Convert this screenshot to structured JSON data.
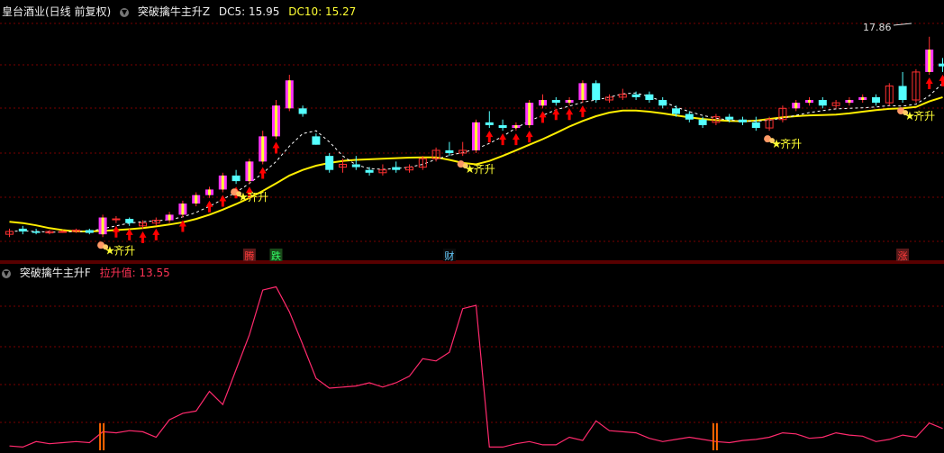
{
  "top_panel": {
    "stock_label": "皇台酒业(日线 前复权)",
    "indicator_name": "突破擒牛主升Z",
    "dc5_label": "DC5: 15.95",
    "dc10_label": "DC10: 15.27",
    "peak_price": "17.86",
    "signal_label": "齐升",
    "tags": [
      "腾",
      "跌",
      "财",
      "涨"
    ]
  },
  "bottom_panel": {
    "indicator_name": "突破擒牛主升F",
    "value_label": "拉升值: 13.55"
  },
  "colors": {
    "background": "#000000",
    "grid": "#7a0000",
    "up_candle": "#ff3030",
    "down_candle": "#54ffff",
    "highlight_bar": "#ff33ff",
    "highlight_bar2": "#ffff33",
    "ma_yellow": "#ffee00",
    "ma_white": "#ffffff",
    "bottom_line": "#ff2a6d",
    "bottom_flag": "#ff6600",
    "arrow": "#ff0000",
    "dc10": "#ffff33"
  },
  "chart_data": {
    "type": "candlestick",
    "note_series": "daily OHLC-like bars estimated visually",
    "candles": [
      {
        "o": 10.8,
        "h": 11.0,
        "l": 10.7,
        "c": 10.9
      },
      {
        "o": 11.0,
        "h": 11.1,
        "l": 10.8,
        "c": 10.9
      },
      {
        "o": 10.9,
        "h": 11.0,
        "l": 10.8,
        "c": 10.85
      },
      {
        "o": 10.85,
        "h": 10.95,
        "l": 10.8,
        "c": 10.9
      },
      {
        "o": 10.9,
        "h": 10.95,
        "l": 10.85,
        "c": 10.9
      },
      {
        "o": 10.9,
        "h": 11.0,
        "l": 10.85,
        "c": 10.95
      },
      {
        "o": 10.95,
        "h": 11.0,
        "l": 10.8,
        "c": 10.85
      },
      {
        "o": 10.8,
        "h": 11.5,
        "l": 10.7,
        "c": 11.4
      },
      {
        "o": 11.35,
        "h": 11.45,
        "l": 11.2,
        "c": 11.35
      },
      {
        "o": 11.35,
        "h": 11.4,
        "l": 11.1,
        "c": 11.2
      },
      {
        "o": 11.1,
        "h": 11.3,
        "l": 11.0,
        "c": 11.2
      },
      {
        "o": 11.2,
        "h": 11.4,
        "l": 11.1,
        "c": 11.3
      },
      {
        "o": 11.3,
        "h": 11.6,
        "l": 11.2,
        "c": 11.5
      },
      {
        "o": 11.5,
        "h": 12.0,
        "l": 11.4,
        "c": 11.9
      },
      {
        "o": 11.9,
        "h": 12.3,
        "l": 11.8,
        "c": 12.2
      },
      {
        "o": 12.2,
        "h": 12.5,
        "l": 12.1,
        "c": 12.4
      },
      {
        "o": 12.4,
        "h": 13.0,
        "l": 12.3,
        "c": 12.9
      },
      {
        "o": 12.9,
        "h": 13.1,
        "l": 12.6,
        "c": 12.7
      },
      {
        "o": 12.7,
        "h": 13.5,
        "l": 12.6,
        "c": 13.4
      },
      {
        "o": 13.4,
        "h": 14.5,
        "l": 13.3,
        "c": 14.3
      },
      {
        "o": 14.3,
        "h": 15.6,
        "l": 14.2,
        "c": 15.4
      },
      {
        "o": 15.3,
        "h": 16.5,
        "l": 15.2,
        "c": 16.3
      },
      {
        "o": 15.3,
        "h": 15.4,
        "l": 15.0,
        "c": 15.1
      },
      {
        "o": 14.3,
        "h": 14.4,
        "l": 14.0,
        "c": 14.0
      },
      {
        "o": 13.6,
        "h": 13.7,
        "l": 13.0,
        "c": 13.1
      },
      {
        "o": 13.2,
        "h": 13.5,
        "l": 13.0,
        "c": 13.3
      },
      {
        "o": 13.3,
        "h": 13.6,
        "l": 13.1,
        "c": 13.2
      },
      {
        "o": 13.1,
        "h": 13.2,
        "l": 12.9,
        "c": 13.0
      },
      {
        "o": 13.0,
        "h": 13.3,
        "l": 12.9,
        "c": 13.1
      },
      {
        "o": 13.2,
        "h": 13.4,
        "l": 13.0,
        "c": 13.1
      },
      {
        "o": 13.1,
        "h": 13.3,
        "l": 13.0,
        "c": 13.2
      },
      {
        "o": 13.2,
        "h": 13.6,
        "l": 13.1,
        "c": 13.5
      },
      {
        "o": 13.5,
        "h": 13.9,
        "l": 13.4,
        "c": 13.8
      },
      {
        "o": 13.8,
        "h": 14.1,
        "l": 13.6,
        "c": 13.7
      },
      {
        "o": 13.7,
        "h": 14.1,
        "l": 13.6,
        "c": 13.8
      },
      {
        "o": 13.8,
        "h": 14.9,
        "l": 13.7,
        "c": 14.8
      },
      {
        "o": 14.8,
        "h": 15.2,
        "l": 14.6,
        "c": 14.7
      },
      {
        "o": 14.7,
        "h": 14.9,
        "l": 14.5,
        "c": 14.6
      },
      {
        "o": 14.6,
        "h": 14.8,
        "l": 14.5,
        "c": 14.7
      },
      {
        "o": 14.7,
        "h": 15.6,
        "l": 14.6,
        "c": 15.5
      },
      {
        "o": 15.4,
        "h": 15.8,
        "l": 15.3,
        "c": 15.6
      },
      {
        "o": 15.6,
        "h": 15.7,
        "l": 15.4,
        "c": 15.5
      },
      {
        "o": 15.5,
        "h": 15.7,
        "l": 15.4,
        "c": 15.6
      },
      {
        "o": 15.6,
        "h": 16.3,
        "l": 15.5,
        "c": 16.2
      },
      {
        "o": 16.2,
        "h": 16.3,
        "l": 15.5,
        "c": 15.6
      },
      {
        "o": 15.6,
        "h": 15.8,
        "l": 15.5,
        "c": 15.7
      },
      {
        "o": 15.7,
        "h": 16.0,
        "l": 15.6,
        "c": 15.8
      },
      {
        "o": 15.8,
        "h": 15.9,
        "l": 15.6,
        "c": 15.7
      },
      {
        "o": 15.8,
        "h": 15.9,
        "l": 15.5,
        "c": 15.6
      },
      {
        "o": 15.6,
        "h": 15.7,
        "l": 15.3,
        "c": 15.4
      },
      {
        "o": 15.3,
        "h": 15.4,
        "l": 15.0,
        "c": 15.1
      },
      {
        "o": 15.1,
        "h": 15.2,
        "l": 14.8,
        "c": 14.9
      },
      {
        "o": 14.9,
        "h": 15.0,
        "l": 14.6,
        "c": 14.7
      },
      {
        "o": 14.8,
        "h": 15.1,
        "l": 14.7,
        "c": 15.0
      },
      {
        "o": 15.0,
        "h": 15.1,
        "l": 14.8,
        "c": 14.9
      },
      {
        "o": 14.9,
        "h": 15.0,
        "l": 14.7,
        "c": 14.8
      },
      {
        "o": 14.8,
        "h": 15.0,
        "l": 14.5,
        "c": 14.6
      },
      {
        "o": 14.6,
        "h": 15.0,
        "l": 14.5,
        "c": 14.9
      },
      {
        "o": 14.9,
        "h": 15.4,
        "l": 14.8,
        "c": 15.3
      },
      {
        "o": 15.3,
        "h": 15.6,
        "l": 15.2,
        "c": 15.5
      },
      {
        "o": 15.5,
        "h": 15.7,
        "l": 15.4,
        "c": 15.6
      },
      {
        "o": 15.6,
        "h": 15.7,
        "l": 15.3,
        "c": 15.4
      },
      {
        "o": 15.4,
        "h": 15.6,
        "l": 15.3,
        "c": 15.5
      },
      {
        "o": 15.5,
        "h": 15.7,
        "l": 15.4,
        "c": 15.6
      },
      {
        "o": 15.6,
        "h": 15.8,
        "l": 15.5,
        "c": 15.7
      },
      {
        "o": 15.7,
        "h": 15.8,
        "l": 15.4,
        "c": 15.5
      },
      {
        "o": 15.5,
        "h": 16.2,
        "l": 15.4,
        "c": 16.1
      },
      {
        "o": 16.1,
        "h": 16.6,
        "l": 15.5,
        "c": 15.6
      },
      {
        "o": 15.6,
        "h": 16.7,
        "l": 15.5,
        "c": 16.6
      },
      {
        "o": 16.6,
        "h": 17.86,
        "l": 16.5,
        "c": 17.4
      },
      {
        "o": 16.9,
        "h": 17.1,
        "l": 16.6,
        "c": 16.8
      }
    ],
    "ma_yellow": [
      11.25,
      11.2,
      11.12,
      11.02,
      10.95,
      10.9,
      10.9,
      10.92,
      10.95,
      10.98,
      11.02,
      11.08,
      11.15,
      11.23,
      11.35,
      11.5,
      11.68,
      11.88,
      12.1,
      12.35,
      12.62,
      12.9,
      13.1,
      13.25,
      13.35,
      13.42,
      13.46,
      13.48,
      13.5,
      13.52,
      13.54,
      13.55,
      13.55,
      13.46,
      13.35,
      13.3,
      13.42,
      13.6,
      13.8,
      14.0,
      14.2,
      14.42,
      14.65,
      14.85,
      15.02,
      15.15,
      15.22,
      15.22,
      15.18,
      15.12,
      15.05,
      14.98,
      14.92,
      14.88,
      14.85,
      14.84,
      14.86,
      14.92,
      14.98,
      15.02,
      15.05,
      15.06,
      15.08,
      15.12,
      15.18,
      15.24,
      15.28,
      15.3,
      15.35,
      15.55,
      15.7
    ],
    "ma_white": [
      10.9,
      10.92,
      10.9,
      10.88,
      10.88,
      10.9,
      10.9,
      11.0,
      11.1,
      11.2,
      11.25,
      11.28,
      11.32,
      11.42,
      11.58,
      11.8,
      12.05,
      12.3,
      12.62,
      12.98,
      13.4,
      13.95,
      14.4,
      14.5,
      14.1,
      13.6,
      13.28,
      13.15,
      13.12,
      13.15,
      13.2,
      13.3,
      13.48,
      13.62,
      13.72,
      13.85,
      14.05,
      14.3,
      14.6,
      14.85,
      15.05,
      15.25,
      15.38,
      15.52,
      15.6,
      15.7,
      15.82,
      15.85,
      15.72,
      15.55,
      15.35,
      15.18,
      15.05,
      14.95,
      14.88,
      14.85,
      14.84,
      14.88,
      14.95,
      15.05,
      15.15,
      15.22,
      15.28,
      15.3,
      15.32,
      15.35,
      15.4,
      15.38,
      15.45,
      15.75,
      16.2
    ],
    "bottom_values": [
      2.2,
      2.1,
      2.6,
      2.4,
      2.5,
      2.6,
      2.5,
      3.5,
      3.4,
      3.6,
      3.5,
      3.0,
      4.6,
      5.2,
      5.4,
      7.2,
      6.0,
      9.2,
      12.4,
      16.5,
      16.8,
      14.5,
      11.5,
      8.4,
      7.5,
      7.6,
      7.7,
      8.0,
      7.6,
      8.0,
      8.6,
      10.2,
      10.0,
      10.8,
      14.8,
      15.1,
      2.1,
      2.1,
      2.4,
      2.6,
      2.3,
      2.3,
      3.0,
      2.7,
      4.5,
      3.6,
      3.5,
      3.4,
      2.9,
      2.6,
      2.8,
      3.0,
      2.8,
      2.6,
      2.5,
      2.7,
      2.8,
      3.0,
      3.4,
      3.3,
      2.9,
      3.0,
      3.4,
      3.2,
      3.1,
      2.6,
      2.8,
      3.2,
      3.0,
      4.3,
      3.8
    ],
    "top_ylim": [
      10.0,
      18.4
    ],
    "bottom_ylim": [
      1.8,
      17.5
    ],
    "highlight_indices": [
      7,
      12,
      13,
      14,
      15,
      16,
      18,
      19,
      20,
      21,
      35,
      37,
      38,
      39,
      40,
      41,
      42,
      43,
      44,
      59,
      60,
      61,
      63,
      64,
      69
    ],
    "arrow_indices": [
      8,
      9,
      10,
      11,
      13,
      15,
      16,
      17,
      18,
      19,
      20,
      36,
      37,
      38,
      39,
      40,
      41,
      42,
      43,
      69,
      70
    ],
    "signal_indices": [
      7,
      17,
      34,
      57,
      67
    ],
    "tag_indices": [
      18,
      20,
      33,
      67
    ],
    "flag_indices": [
      7,
      53
    ]
  }
}
